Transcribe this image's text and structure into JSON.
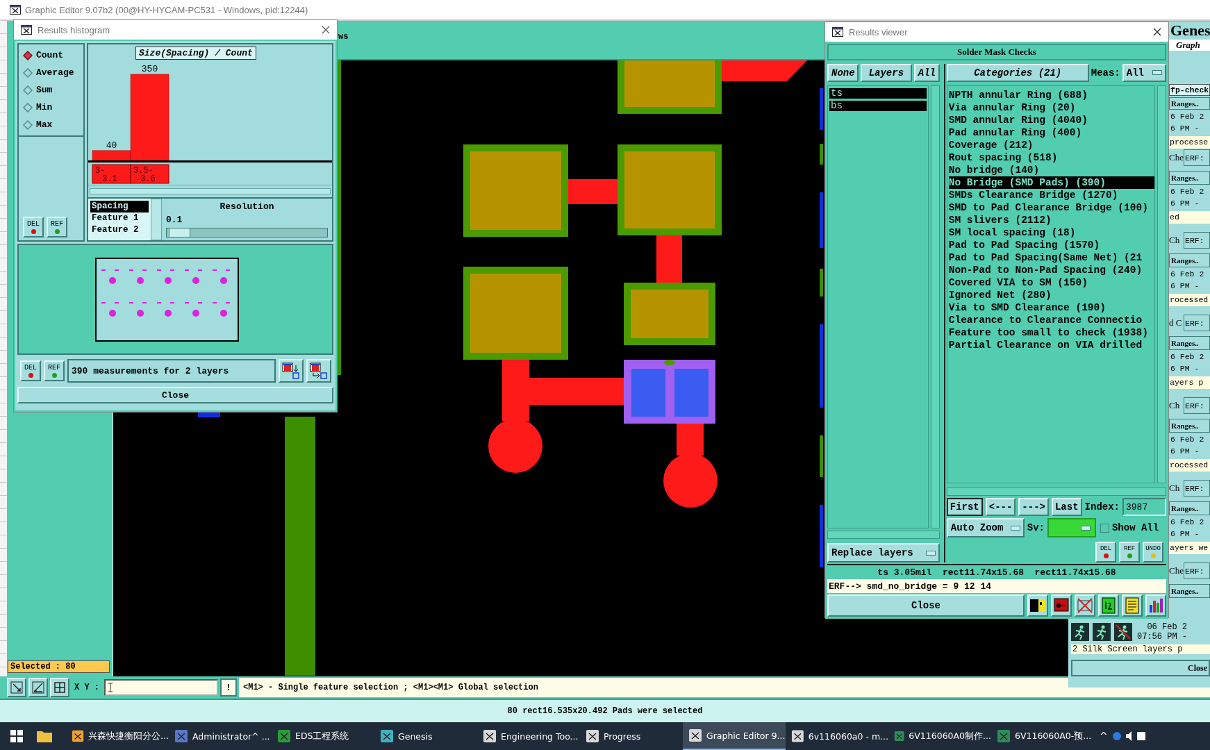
{
  "main_window": {
    "title": "Graphic Editor 9.07b2 (00@HY-HYCAM-PC531 - Windows, pid:12244)",
    "toolbar_fragment": "ws",
    "selected_count": "Selected : 80",
    "coord_label": "X Y :",
    "coord_button": "!",
    "hint": "<M1> - Single feature selection ; <M1><M1> Global selection",
    "status": "80 rect16.535x20.492 Pads were selected"
  },
  "histogram": {
    "title": "Results histogram",
    "modes": [
      {
        "label": "Count",
        "selected": true
      },
      {
        "label": "Average",
        "selected": false
      },
      {
        "label": "Sum",
        "selected": false
      },
      {
        "label": "Min",
        "selected": false
      },
      {
        "label": "Max",
        "selected": false
      }
    ],
    "top_buttons": [
      "DEL",
      "REF"
    ],
    "chart_data": {
      "type": "bar",
      "title": "Size(Spacing) / Count",
      "categories": [
        "3-3.1",
        "3.5-3.6"
      ],
      "values": [
        40,
        350
      ],
      "data_labels": true
    },
    "fields": [
      {
        "label": "Spacing",
        "selected": true
      },
      {
        "label": "Feature 1",
        "selected": false
      },
      {
        "label": "Feature 2",
        "selected": false
      }
    ],
    "resolution_label": "Resolution",
    "resolution_value": "0.1",
    "resolution_slider": {
      "level": 0.03
    },
    "bottom_buttons": [
      "DEL",
      "REF"
    ],
    "summary": "390 measurements for 2 layers",
    "close": "Close"
  },
  "results_viewer": {
    "title": "Results viewer",
    "heading": "Solder Mask Checks",
    "none_button": "None",
    "layers_button": "Layers",
    "all_button": "All",
    "categories_button": "Categories (21)",
    "meas_label": "Meas:",
    "meas_value": "All",
    "layers": [
      {
        "name": "ts",
        "selected": true
      },
      {
        "name": "bs",
        "selected": true
      }
    ],
    "categories": [
      {
        "label": "NPTH annular Ring (688)",
        "selected": false
      },
      {
        "label": "Via annular Ring (20)",
        "selected": false
      },
      {
        "label": "SMD annular Ring (4040)",
        "selected": false
      },
      {
        "label": "Pad annular Ring (400)",
        "selected": false
      },
      {
        "label": "Coverage (212)",
        "selected": false
      },
      {
        "label": "Rout spacing (518)",
        "selected": false
      },
      {
        "label": "No bridge (140)",
        "selected": false
      },
      {
        "label": "No Bridge (SMD Pads) (390)",
        "selected": true
      },
      {
        "label": "SMDs Clearance Bridge (1270)",
        "selected": false
      },
      {
        "label": "SMD to Pad Clearance Bridge (100)",
        "selected": false
      },
      {
        "label": "SM slivers (2112)",
        "selected": false
      },
      {
        "label": "SM local spacing (18)",
        "selected": false
      },
      {
        "label": "Pad to Pad Spacing (1570)",
        "selected": false
      },
      {
        "label": "Pad to Pad Spacing(Same Net) (21",
        "selected": false
      },
      {
        "label": "Non-Pad to Non-Pad Spacing (240)",
        "selected": false
      },
      {
        "label": "Covered VIA to SM (150)",
        "selected": false
      },
      {
        "label": "Ignored Net (280)",
        "selected": false
      },
      {
        "label": "Via to SMD Clearance (190)",
        "selected": false
      },
      {
        "label": "Clearance to Clearance Connectio",
        "selected": false
      },
      {
        "label": "Feature too small to check (1938)",
        "selected": false
      },
      {
        "label": "Partial Clearance on VIA drilled",
        "selected": false
      }
    ],
    "nav_buttons": [
      "First",
      "<---",
      "--->",
      "Last"
    ],
    "index_label": "Index:",
    "index_value": "3987",
    "zoom_mode": "Auto Zoom",
    "sv_label": "Sv:",
    "show_all": {
      "label": "Show All",
      "checked": false
    },
    "replace_mode": "Replace layers",
    "edit_buttons": [
      "DEL",
      "REF",
      "UNDO"
    ],
    "measurement": "ts 3.05mil  rect11.74x15.68  rect11.74x15.68",
    "erf_line": "ERF--> smd_no_bridge = 9 12 14",
    "close": "Close"
  },
  "genesis_window": {
    "title": "Genes",
    "subtitle": "Graph",
    "entries": [
      {
        "label": "fp-check",
        "ranges": "Ranges..",
        "date": "6 Feb 2",
        "time": "6 PM -",
        "status": "processe"
      },
      {
        "label": "Che",
        "button": "ERF:",
        "ranges": "Ranges..",
        "date": "6 Feb 2",
        "time": "6 PM -",
        "status": "ed"
      },
      {
        "label": "Ch",
        "button": "ERF:",
        "ranges": "Ranges..",
        "date": "6 Feb 2",
        "time": "6 PM -",
        "status": "rocessed"
      },
      {
        "label": "d C",
        "button": "ERF:",
        "ranges": "Ranges..",
        "date": "6 Feb 2",
        "time": "6 PM -",
        "status": "ayers p"
      },
      {
        "label": "Ch",
        "button": "ERF:",
        "ranges": "Ranges..",
        "date": "6 Feb 2",
        "time": "6 PM -",
        "status": "rocessed"
      },
      {
        "label": "Ch",
        "button": "ERF:",
        "ranges": "Ranges..",
        "date": "6 Feb 2",
        "time": "6 PM -",
        "status": "ayers we"
      },
      {
        "label": "Che",
        "button": "ERF:",
        "ranges": "Ranges..",
        "date": "06 Feb 2",
        "time": "07:56 PM -",
        "status": "2 Silk Screen layers p"
      }
    ],
    "close": "Close"
  },
  "taskbar": {
    "items": [
      {
        "label": "兴森快捷衡阳分公...",
        "selected": false
      },
      {
        "label": "Administrator^ ...",
        "selected": false
      },
      {
        "label": "EDS工程系统",
        "selected": false
      },
      {
        "label": "Genesis",
        "selected": false
      },
      {
        "label": "Engineering Too...",
        "selected": false
      },
      {
        "label": "Progress",
        "selected": false
      },
      {
        "label": "Graphic Editor 9...",
        "selected": true
      },
      {
        "label": "6v116060a0 - m...",
        "selected": false
      },
      {
        "label": "6V116060A0制作...",
        "selected": false
      },
      {
        "label": "6V116060A0-预...",
        "selected": false
      }
    ],
    "tray_toggle": "^"
  }
}
